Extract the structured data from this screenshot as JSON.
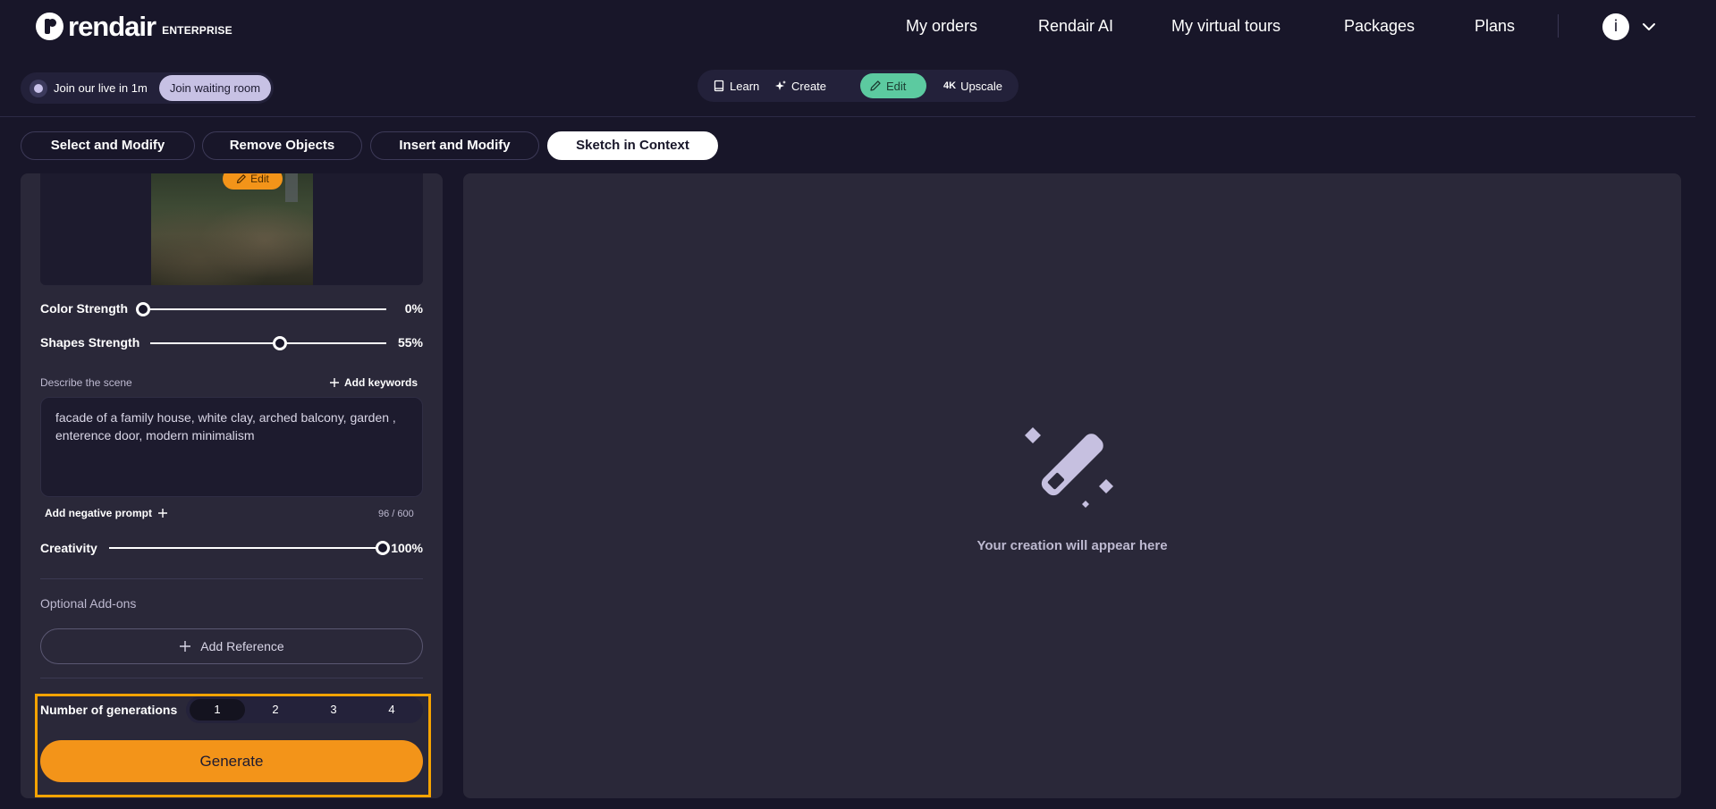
{
  "brand": {
    "name": "rendair",
    "badge": "ENTERPRISE"
  },
  "nav": {
    "items": [
      "My orders",
      "Rendair AI",
      "My virtual tours",
      "Packages",
      "Plans"
    ],
    "user_initial": "i"
  },
  "live": {
    "text": "Join our live in 1m",
    "button": "Join waiting room"
  },
  "modes": {
    "items": [
      "Learn",
      "Create",
      "Edit",
      "Upscale"
    ],
    "upscale_prefix": "4K",
    "active": "Edit"
  },
  "tabs": {
    "items": [
      "Select and Modify",
      "Remove Objects",
      "Insert and Modify",
      "Sketch in Context"
    ],
    "active": "Sketch in Context"
  },
  "panel": {
    "edit_label": "Edit",
    "color_strength": {
      "label": "Color Strength",
      "value": 0,
      "display": "0%"
    },
    "shapes_strength": {
      "label": "Shapes Strength",
      "value": 55,
      "display": "55%"
    },
    "describe_label": "Describe the scene",
    "add_keywords": "Add keywords",
    "prompt": "facade of a family house, white clay, arched balcony, garden , enterence door, modern minimalism",
    "negative_prompt": "Add negative prompt",
    "char_count": "96 / 600",
    "creativity": {
      "label": "Creativity",
      "value": 100,
      "display": "100%"
    },
    "optional_addons": "Optional Add-ons",
    "add_reference": "Add Reference",
    "generations": {
      "label": "Number of generations",
      "options": [
        "1",
        "2",
        "3",
        "4"
      ],
      "selected": "1"
    },
    "generate": "Generate"
  },
  "preview": {
    "placeholder": "Your creation will appear here"
  },
  "colors": {
    "accent": "#f39419",
    "edit_active": "#5ccaa0",
    "highlight": "#f5a300",
    "background": "#181629",
    "panel": "#2a2839"
  }
}
